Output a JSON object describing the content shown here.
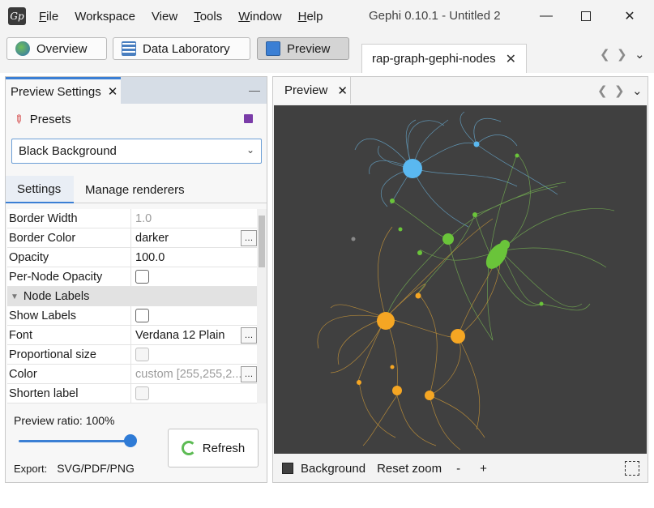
{
  "menu": {
    "items": [
      {
        "label": "File",
        "u": "F",
        "rest": "ile"
      },
      {
        "label": "Workspace",
        "u": "",
        "rest": "Workspace"
      },
      {
        "label": "View",
        "u": "",
        "rest": "View"
      },
      {
        "label": "Tools",
        "u": "T",
        "rest": "ools"
      },
      {
        "label": "Window",
        "u": "W",
        "rest": "indow"
      },
      {
        "label": "Help",
        "u": "H",
        "rest": "elp"
      }
    ],
    "window_title": "Gephi 0.10.1 - Untitled 2"
  },
  "toolbar": {
    "overview_label": "Overview",
    "data_lab_label": "Data Laboratory",
    "preview_label": "Preview",
    "doc_tab_label": "rap-graph-gephi-nodes"
  },
  "left_panel": {
    "tab_label": "Preview Settings",
    "presets_label": "Presets",
    "preset_value": "Black Background",
    "sub_tabs": [
      "Settings",
      "Manage renderers"
    ],
    "props": {
      "border_width_name": "Border Width",
      "border_width_val": "1.0",
      "border_color_name": "Border Color",
      "border_color_val": "darker",
      "opacity_name": "Opacity",
      "opacity_val": "100.0",
      "per_node_opacity_name": "Per-Node Opacity",
      "node_labels_cat": "Node Labels",
      "show_labels_name": "Show Labels",
      "font_name": "Font",
      "font_val": "Verdana 12 Plain",
      "proportional_size_name": "Proportional size",
      "color_name": "Color",
      "color_val": "custom [255,255,2...",
      "shorten_label_name": "Shorten label"
    },
    "ratio_label": "Preview ratio:",
    "ratio_value": "100%",
    "refresh_label": "Refresh",
    "export_label": "Export:",
    "export_formats": "SVG/PDF/PNG"
  },
  "preview_panel": {
    "tab_label": "Preview",
    "background_label": "Background",
    "reset_zoom_label": "Reset zoom",
    "zoom_out_label": "-",
    "zoom_in_label": "+"
  },
  "colors": {
    "canvas_bg": "#404040",
    "blue": "#5ab8f0",
    "green": "#6ac43a",
    "orange": "#f5a623",
    "accent": "#3b7fd4"
  }
}
